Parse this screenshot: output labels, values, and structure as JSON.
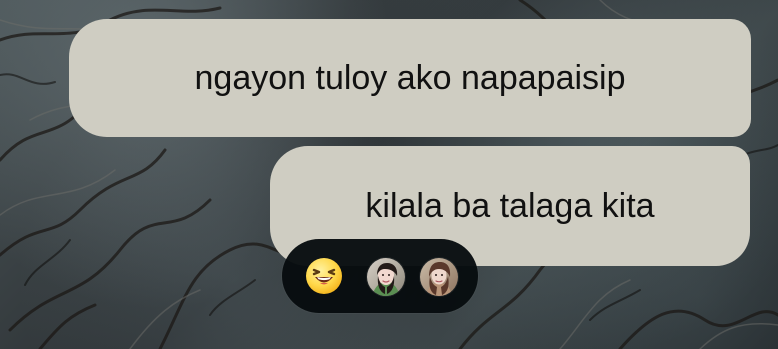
{
  "messages": [
    {
      "text": "ngayon tuloy ako napapaisip"
    },
    {
      "text": "kilala ba talaga kita"
    }
  ],
  "reactions": {
    "emoji_icon": "laughing-squinting-face-icon",
    "avatars": [
      {
        "icon": "reacting-user-avatar-1"
      },
      {
        "icon": "reacting-user-avatar-2"
      }
    ]
  },
  "colors": {
    "bubble": "#cfcdc2",
    "reaction_bar": "#070c0f",
    "emoji": "#ffd84a"
  }
}
